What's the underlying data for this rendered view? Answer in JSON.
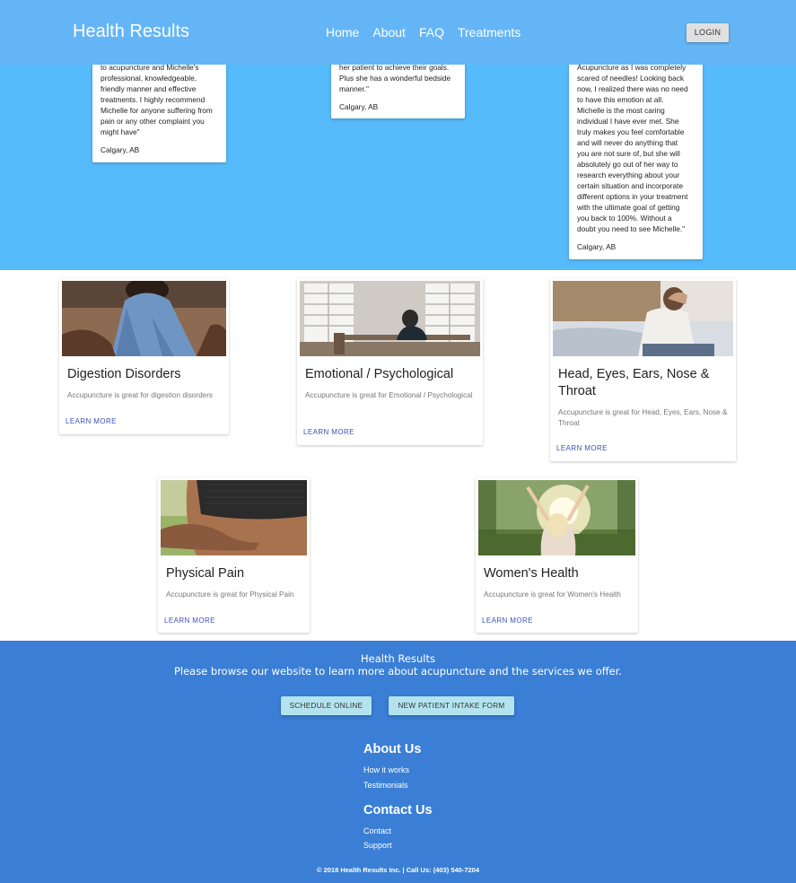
{
  "header": {
    "brand": "Health Results",
    "nav": [
      "Home",
      "About",
      "FAQ",
      "Treatments"
    ],
    "login_label": "LOGIN"
  },
  "testimonials": [
    {
      "quote": "to acupuncture and Michelle's\nprofessional, knowledgeable,\nfriendly manner and effective\ntreatments. I highly recommend\nMichelle for anyone suffering from\npain or any other complaint you\nmight have\"",
      "location": "Calgary, AB"
    },
    {
      "quote": "her patient to achieve their goals.\nPlus she has a wonderful bedside\nmanner.\"",
      "location": "Calgary, AB"
    },
    {
      "quote": "Acupuncture as I was completely\nscared of needles! Looking back\nnow, I realized there was no need\nto have this emotion at all.\nMichelle is the most caring\nindividual I have ever met. She\ntruly makes you feel comfortable\nand will never do anything that\nyou are not sure of, but she will\nabsolutely go out of her way to\nresearch everything about your\ncertain situation and incorporate\ndifferent options in your treatment\nwith the ultimate goal of getting\nyou back to 100%. Without a\ndoubt you need to see Michelle.\"",
      "location": "Calgary, AB"
    }
  ],
  "services": [
    {
      "title": "Digestion Disorders",
      "description": "Accupuncture is great for digestion disorders",
      "link": "LEARN MORE"
    },
    {
      "title": "Emotional / Psychological",
      "description": "Accupuncture is great for Emotional / Psychological",
      "link": "LEARN MORE"
    },
    {
      "title": "Head, Eyes, Ears, Nose & Throat",
      "description": "Accupuncture is great for Head, Eyes, Ears, Nose & Throat",
      "link": "LEARN MORE"
    },
    {
      "title": "Physical Pain",
      "description": "Accupuncture is great for Physical Pain",
      "link": "LEARN MORE"
    },
    {
      "title": "Women's Health",
      "description": "Accupuncture is great for Women's Health",
      "link": "LEARN MORE"
    }
  ],
  "footer": {
    "title": "Health Results",
    "subtitle": "Please browse our website to learn more about acupuncture and the services we offer.",
    "schedule_label": "SCHEDULE ONLINE",
    "intake_label": "NEW PATIENT INTAKE FORM",
    "about_heading": "About Us",
    "about_links": [
      "How it works",
      "Testimonials"
    ],
    "contact_heading": "Contact Us",
    "contact_links": [
      "Contact",
      "Support"
    ],
    "copyright": "© 2018 Health Results Inc. | Call Us: (403) 540-7204"
  },
  "colors": {
    "header": "#64b5f6",
    "band": "#56bbfb",
    "footer": "#3a7fd5",
    "link": "#3f51b5"
  }
}
